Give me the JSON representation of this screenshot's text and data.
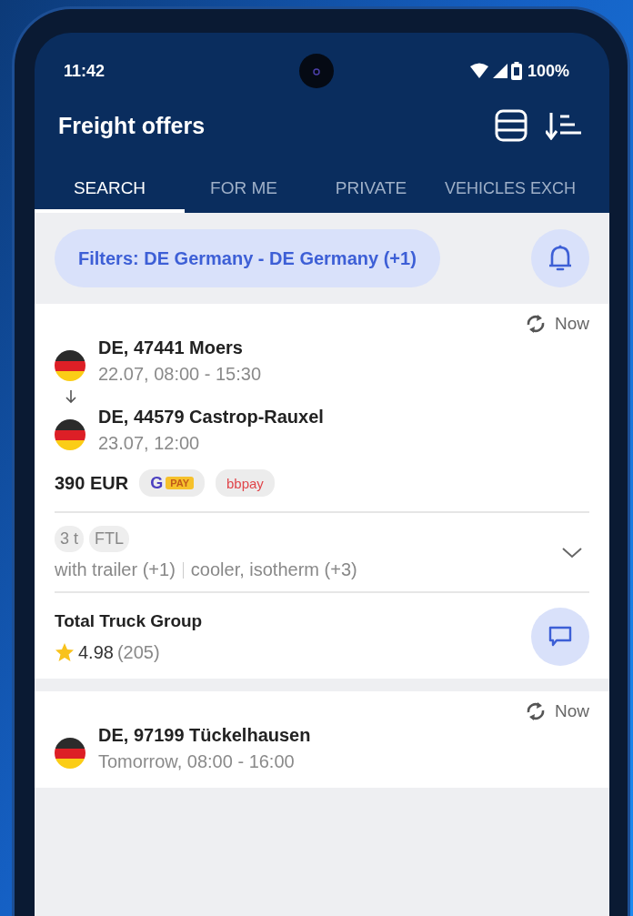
{
  "status_bar": {
    "time": "11:42",
    "battery": "100%"
  },
  "app_bar": {
    "title": "Freight offers"
  },
  "tabs": [
    {
      "label": "SEARCH",
      "selected": true
    },
    {
      "label": "FOR ME",
      "selected": false
    },
    {
      "label": "PRIVATE",
      "selected": false
    },
    {
      "label": "VEHICLES EXCH",
      "selected": false
    }
  ],
  "filter": {
    "label": "Filters: DE Germany - DE Germany (+1)"
  },
  "offers": [
    {
      "updated": "Now",
      "stops": [
        {
          "place": "DE, 47441 Moers",
          "time": "22.07, 08:00 - 15:30"
        },
        {
          "place": "DE, 44579 Castrop-Rauxel",
          "time": "23.07, 12:00"
        }
      ],
      "price": "390 EUR",
      "payments": [
        {
          "kind": "gpay",
          "mark": "G",
          "label": "PAY"
        },
        {
          "kind": "bbpay",
          "label": "bbpay"
        }
      ],
      "tags": [
        "3 t",
        "FTL"
      ],
      "details": [
        "with trailer (+1)",
        "cooler, isotherm (+3)"
      ],
      "company": "Total Truck Group",
      "rating": "4.98",
      "reviews": "(205)"
    },
    {
      "updated": "Now",
      "stops": [
        {
          "place": "DE, 97199 Tückelhausen",
          "time": "Tomorrow, 08:00 - 16:00"
        }
      ]
    }
  ]
}
